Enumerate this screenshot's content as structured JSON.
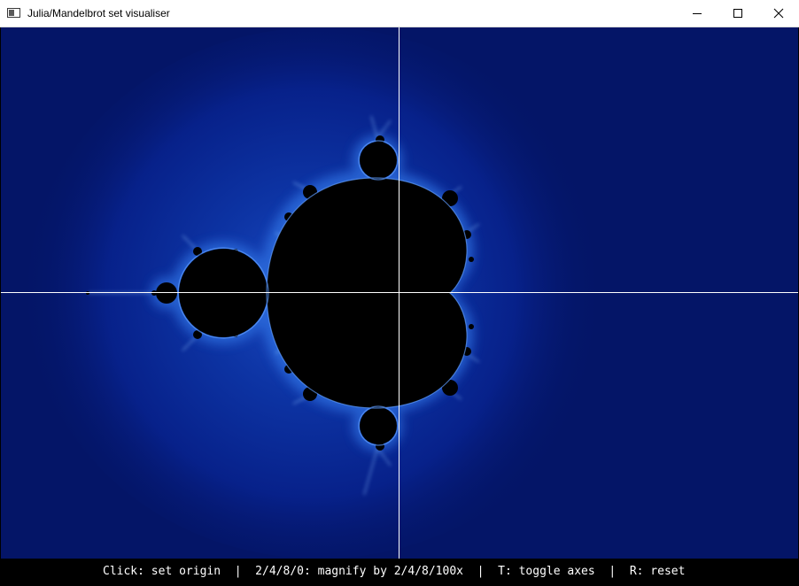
{
  "window": {
    "title": "Julia/Mandelbrot set visualiser"
  },
  "titlebar_buttons": {
    "minimize_icon": "minimize-icon",
    "maximize_icon": "maximize-icon",
    "close_icon": "close-icon"
  },
  "status": {
    "help_text": "Click: set origin  |  2/4/8/0: magnify by 2/4/8/100x  |  T: toggle axes  |  R: reset"
  },
  "view": {
    "fractal": "Mandelbrot set",
    "axes_visible": true
  },
  "colors": {
    "background": "#041567",
    "glow": "#1a4fc0",
    "edge": "#7fb6ff",
    "set_interior": "#000000",
    "axes": "#ffffff"
  }
}
